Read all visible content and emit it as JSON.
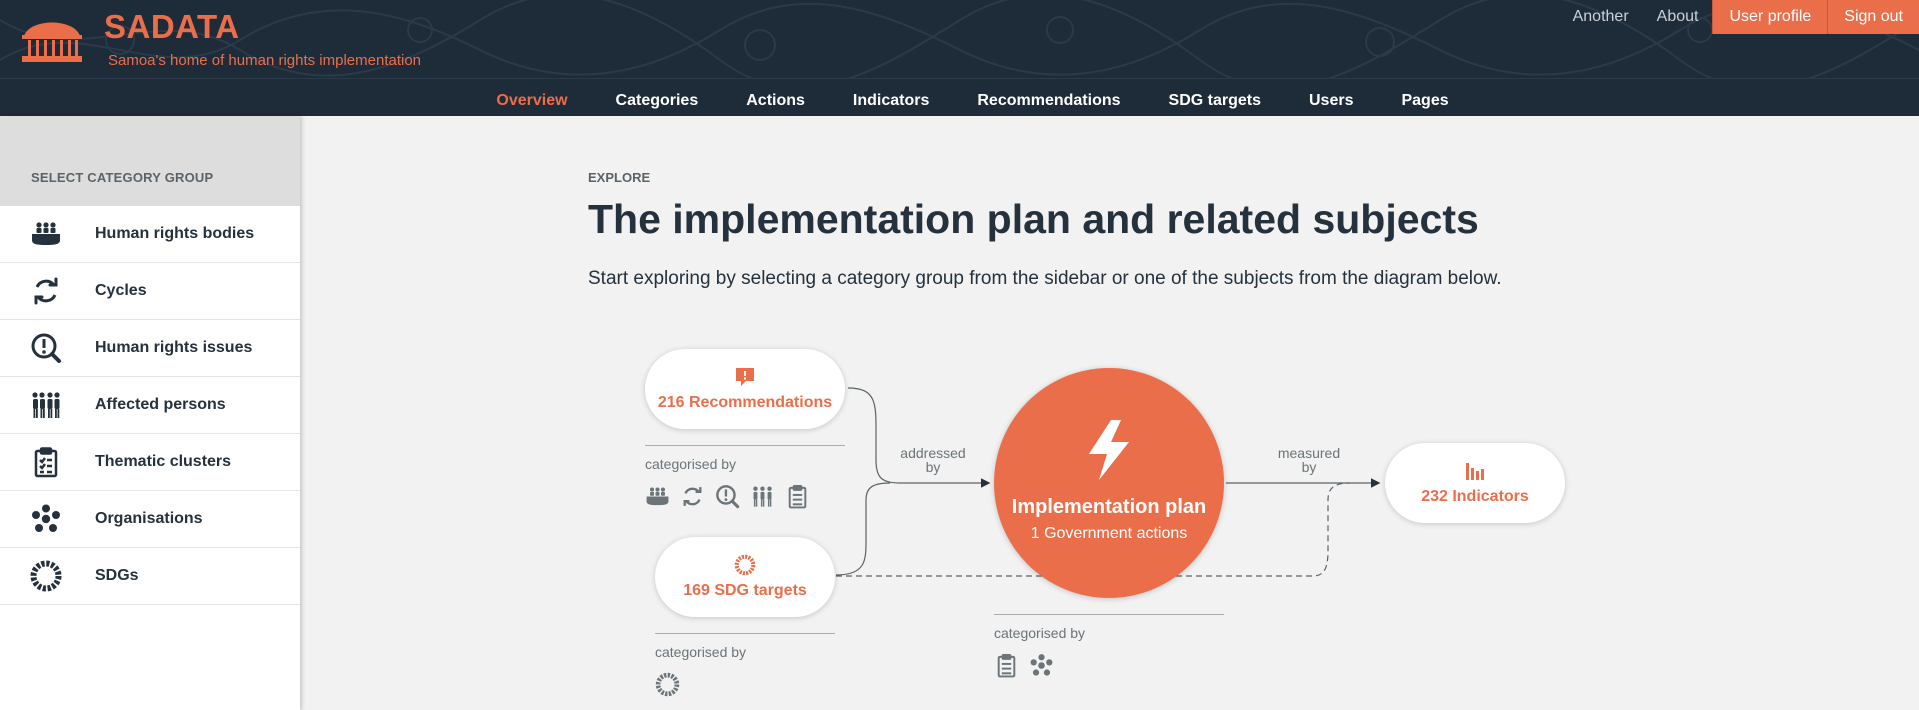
{
  "brand": {
    "title": "SADATA",
    "subtitle": "Samoa's home of human rights implementation"
  },
  "top_links": [
    {
      "label": "Another"
    },
    {
      "label": "About"
    },
    {
      "label": "User profile"
    },
    {
      "label": "Sign out"
    }
  ],
  "nav": {
    "items": [
      {
        "label": "Overview",
        "active": true
      },
      {
        "label": "Categories"
      },
      {
        "label": "Actions"
      },
      {
        "label": "Indicators"
      },
      {
        "label": "Recommendations"
      },
      {
        "label": "SDG targets"
      },
      {
        "label": "Users"
      },
      {
        "label": "Pages"
      }
    ]
  },
  "sidebar": {
    "heading": "SELECT CATEGORY GROUP",
    "items": [
      {
        "label": "Human rights bodies",
        "icon": "human-rights-bodies-icon"
      },
      {
        "label": "Cycles",
        "icon": "cycles-icon"
      },
      {
        "label": "Human rights issues",
        "icon": "human-rights-issues-icon"
      },
      {
        "label": "Affected persons",
        "icon": "affected-persons-icon"
      },
      {
        "label": "Thematic clusters",
        "icon": "thematic-clusters-icon"
      },
      {
        "label": "Organisations",
        "icon": "organisations-icon"
      },
      {
        "label": "SDGs",
        "icon": "sdgs-icon"
      }
    ]
  },
  "main": {
    "eyebrow": "EXPLORE",
    "title": "The implementation plan and related subjects",
    "intro": "Start exploring by selecting a category group from the sidebar or one of the subjects from the diagram below."
  },
  "diagram": {
    "recommendations": {
      "label": "216 Recommendations",
      "icon": "speech-bubble-icon"
    },
    "sdg_targets": {
      "label": "169 SDG targets",
      "icon": "sdg-wheel-icon"
    },
    "plan": {
      "title": "Implementation plan",
      "subtitle": "1 Government actions",
      "icon": "lightning-icon"
    },
    "indicators": {
      "label": "232 Indicators",
      "icon": "bar-chart-icon"
    },
    "edge_addressed": [
      "addressed",
      "by"
    ],
    "edge_measured": [
      "measured",
      "by"
    ],
    "categorised_by": "categorised by"
  },
  "colors": {
    "accent": "#eb6e4b",
    "header_bg": "#1e2b39",
    "text": "#25313d",
    "page_bg": "#f1f2f1"
  }
}
